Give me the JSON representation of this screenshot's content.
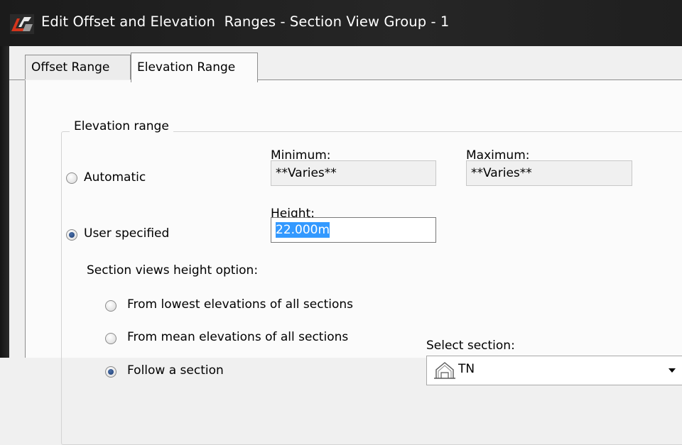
{
  "window": {
    "title": "Edit Offset and Elevation  Ranges - Section View Group - 1"
  },
  "tabs": [
    {
      "label": "Offset Range",
      "active": false
    },
    {
      "label": "Elevation Range",
      "active": true
    }
  ],
  "elevation_range": {
    "group_label": "Elevation range",
    "automatic_label": "Automatic",
    "minimum_label": "Minimum:",
    "minimum_value": "**Varies**",
    "maximum_label": "Maximum:",
    "maximum_value": "**Varies**",
    "user_specified_label": "User specified",
    "height_label": "Height:",
    "height_value": "22.000m",
    "mode": "User specified"
  },
  "height_option": {
    "label": "Section views height option:",
    "options": [
      {
        "label": "From lowest elevations of all sections",
        "checked": false
      },
      {
        "label": "From mean elevations of all sections",
        "checked": false
      },
      {
        "label": "Follow a section",
        "checked": true
      }
    ],
    "select_label": "Select section:",
    "select_value": "TN",
    "select_icon": "section-view-icon"
  },
  "colors": {
    "selection": "#3399ff",
    "titlebar": "#1f1f1f",
    "title_icon_red": "#d4351c"
  }
}
